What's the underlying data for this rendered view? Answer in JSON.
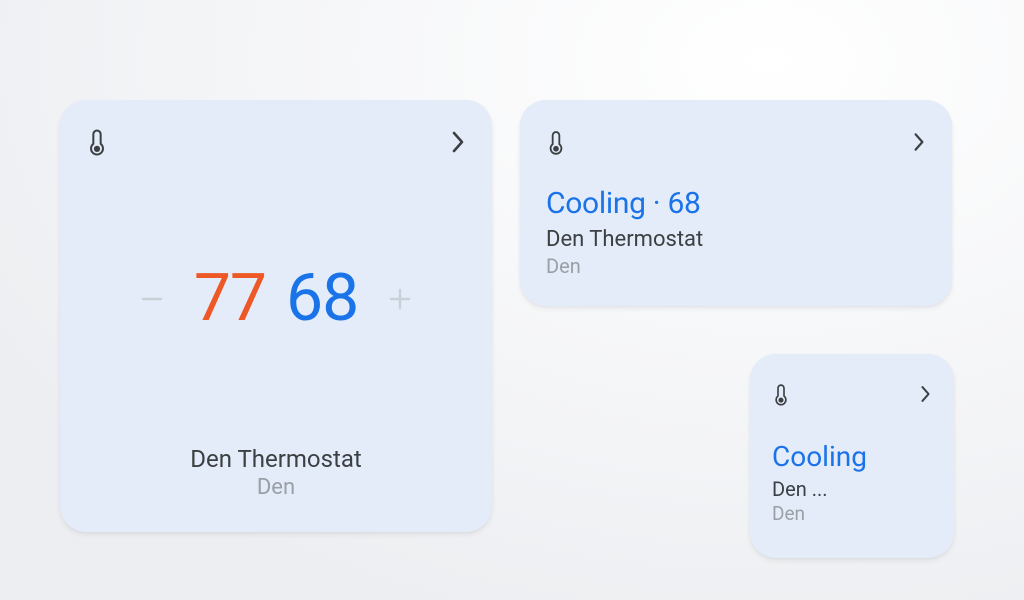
{
  "colors": {
    "card_bg": "#e4ecf9",
    "heat": "#ee5826",
    "cool": "#1a73e8",
    "text": "#3c4043",
    "muted": "#9aa0a6",
    "faded": "#c9cfd6"
  },
  "large_card": {
    "heat_setpoint": "77",
    "cool_setpoint": "68",
    "device_name": "Den Thermostat",
    "room": "Den"
  },
  "medium_card": {
    "status_line": "Cooling · 68",
    "device_name": "Den Thermostat",
    "room": "Den"
  },
  "small_card": {
    "status_line": "Cooling",
    "device_name_truncated": "Den ...",
    "room": "Den"
  }
}
